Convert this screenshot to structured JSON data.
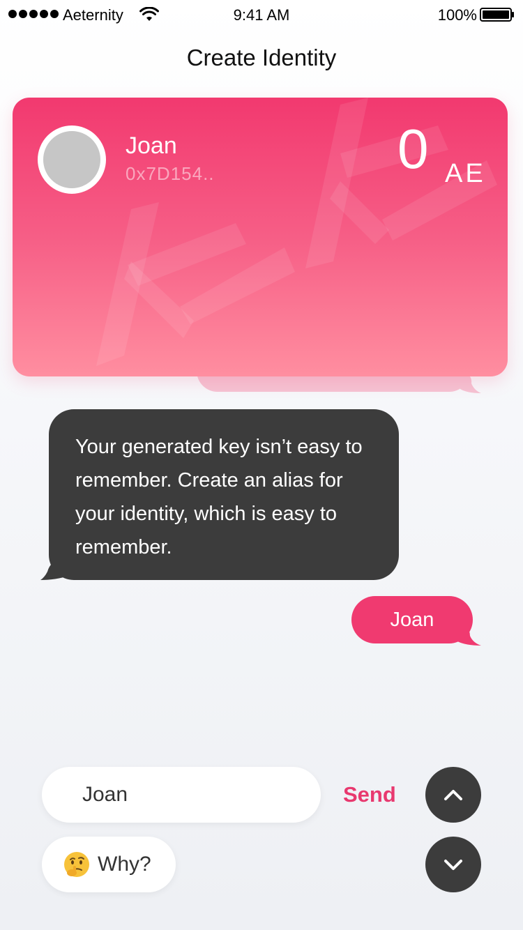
{
  "status_bar": {
    "carrier": "Aeternity",
    "time": "9:41 AM",
    "battery": "100%"
  },
  "header": {
    "title": "Create Identity"
  },
  "identity_card": {
    "name": "Joan",
    "address": "0x7D154..",
    "balance": "0",
    "unit": "AE"
  },
  "chat": {
    "bot_message": "Your generated key isn’t easy to remember. Create an alias for your identity, which is easy to remember.",
    "user_message": "Joan"
  },
  "input": {
    "value": "Joan",
    "send_label": "Send"
  },
  "why_button": {
    "label": "Why?"
  },
  "colors": {
    "accent": "#f03a70",
    "card_gradient_top": "#f2396f",
    "card_gradient_bottom": "#ff8ea0",
    "dark_bubble": "#3c3c3c"
  },
  "icons": {
    "scroll_up": "chevron-up-icon",
    "scroll_down": "chevron-down-icon",
    "why": "thinking-face-icon"
  }
}
